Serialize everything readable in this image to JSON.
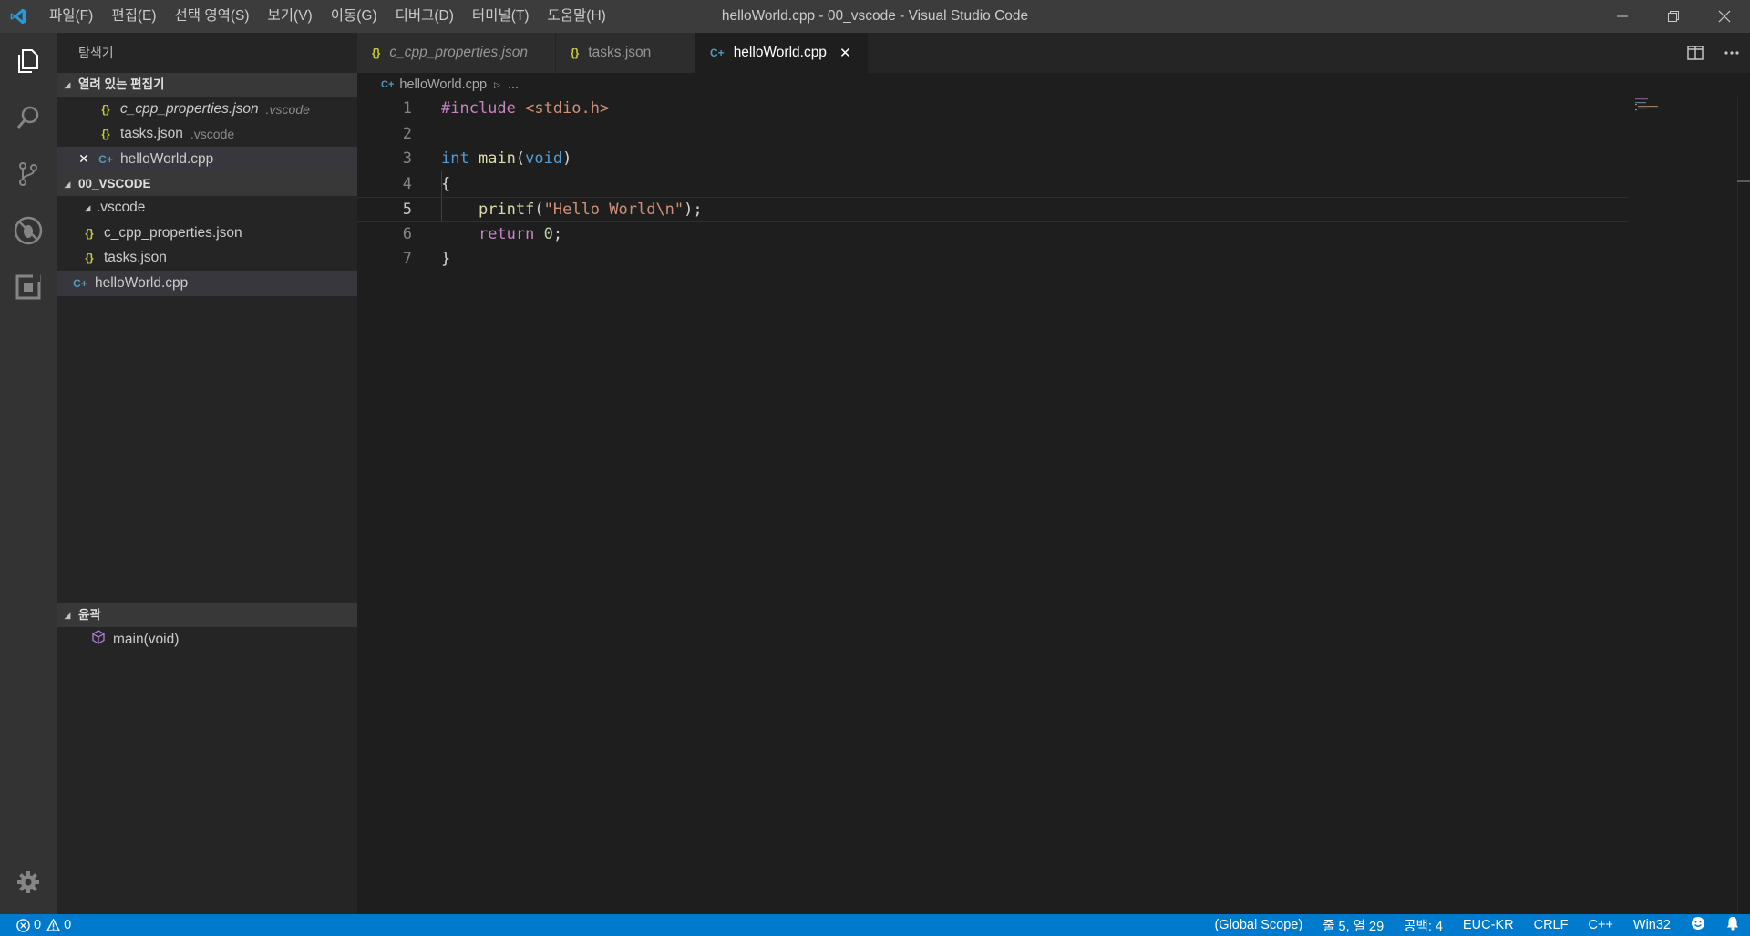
{
  "window": {
    "title": "helloWorld.cpp - 00_vscode - Visual Studio Code",
    "menu": [
      "파일(F)",
      "편집(E)",
      "선택 영역(S)",
      "보기(V)",
      "이동(G)",
      "디버그(D)",
      "터미널(T)",
      "도움말(H)"
    ]
  },
  "sidebar": {
    "title": "탐색기",
    "open_editors": {
      "header": "열려 있는 편집기",
      "items": [
        {
          "icon": "{}",
          "name": "c_cpp_properties.json",
          "desc": ".vscode"
        },
        {
          "icon": "{}",
          "name": "tasks.json",
          "desc": ".vscode"
        },
        {
          "icon": "C+",
          "name": "helloWorld.cpp",
          "close": "✕"
        }
      ]
    },
    "folder": {
      "header": "00_VSCODE",
      "items": [
        {
          "name": ".vscode"
        },
        {
          "icon": "{}",
          "name": "c_cpp_properties.json"
        },
        {
          "icon": "{}",
          "name": "tasks.json"
        },
        {
          "icon": "C+",
          "name": "helloWorld.cpp"
        }
      ]
    },
    "outline": {
      "header": "윤곽",
      "items": [
        {
          "name": "main(void)"
        }
      ]
    }
  },
  "tabs": [
    {
      "icon": "{}",
      "label": "c_cpp_properties.json"
    },
    {
      "icon": "{}",
      "label": "tasks.json"
    },
    {
      "icon": "C+",
      "label": "helloWorld.cpp",
      "close": "✕"
    }
  ],
  "breadcrumb": {
    "file": "helloWorld.cpp",
    "more": "..."
  },
  "editor": {
    "current_line": 5,
    "lines": [
      {
        "n": "1",
        "tokens": [
          [
            "kw-dir",
            "#include "
          ],
          [
            "str",
            "<stdio.h>"
          ]
        ]
      },
      {
        "n": "2",
        "tokens": []
      },
      {
        "n": "3",
        "tokens": [
          [
            "typ",
            "int"
          ],
          [
            "plain",
            " "
          ],
          [
            "fn",
            "main"
          ],
          [
            "plain",
            "("
          ],
          [
            "typ",
            "void"
          ],
          [
            "plain",
            ")"
          ]
        ]
      },
      {
        "n": "4",
        "tokens": [
          [
            "plain",
            "{"
          ]
        ]
      },
      {
        "n": "5",
        "tokens": [
          [
            "plain",
            "    "
          ],
          [
            "fn",
            "printf"
          ],
          [
            "plain",
            "("
          ],
          [
            "str",
            "\"Hello World\\n\""
          ],
          [
            "plain",
            ");"
          ]
        ]
      },
      {
        "n": "6",
        "tokens": [
          [
            "plain",
            "    "
          ],
          [
            "ctl",
            "return"
          ],
          [
            "plain",
            " "
          ],
          [
            "num",
            "0"
          ],
          [
            "plain",
            ";"
          ]
        ]
      },
      {
        "n": "7",
        "tokens": [
          [
            "plain",
            "}"
          ]
        ]
      }
    ]
  },
  "status": {
    "errors": "0",
    "warnings": "0",
    "scope": "(Global Scope)",
    "position": "줄 5, 열 29",
    "spaces": "공백: 4",
    "encoding": "EUC-KR",
    "eol": "CRLF",
    "language": "C++",
    "platform": "Win32"
  },
  "colors": {
    "accent": "#007acc",
    "activitybar": "#333333",
    "sidebar": "#252526",
    "editor": "#1e1e1e",
    "titlebar": "#3c3c3c"
  }
}
